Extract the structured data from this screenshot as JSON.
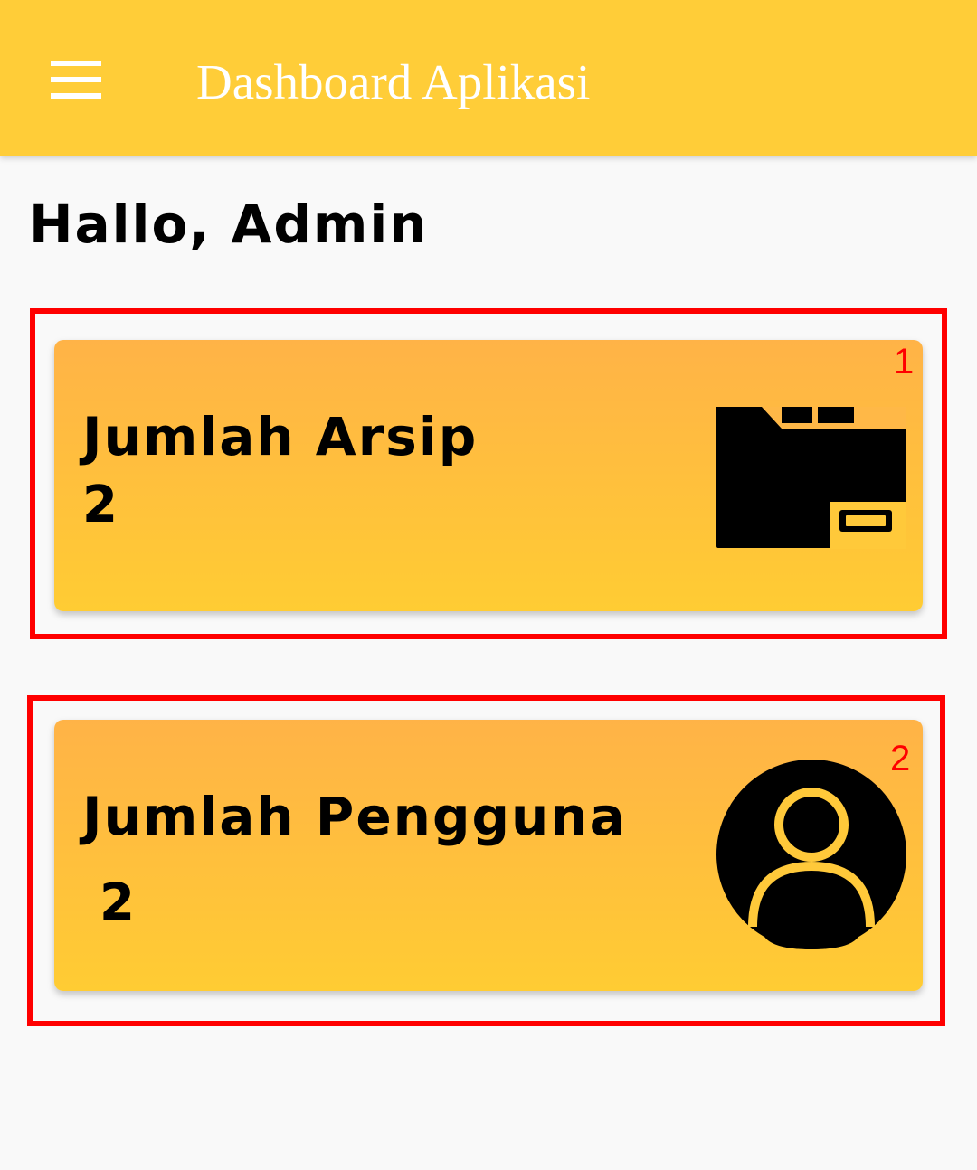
{
  "appbar": {
    "title": "Dashboard Aplikasi",
    "menu_icon": "hamburger-menu-icon",
    "background_color": "#ffcd38"
  },
  "greeting": "Hallo, Admin",
  "cards": [
    {
      "label": "Jumlah Arsip",
      "count": "2",
      "icon": "archive-folder-icon",
      "marker": "1"
    },
    {
      "label": "Jumlah Pengguna",
      "count": "2",
      "icon": "user-account-icon",
      "marker": "2"
    }
  ],
  "colors": {
    "card_gradient_top": "#ffb347",
    "card_gradient_bottom": "#ffcc33",
    "highlight": "#ff0000",
    "page_background": "#f9f9f9"
  }
}
